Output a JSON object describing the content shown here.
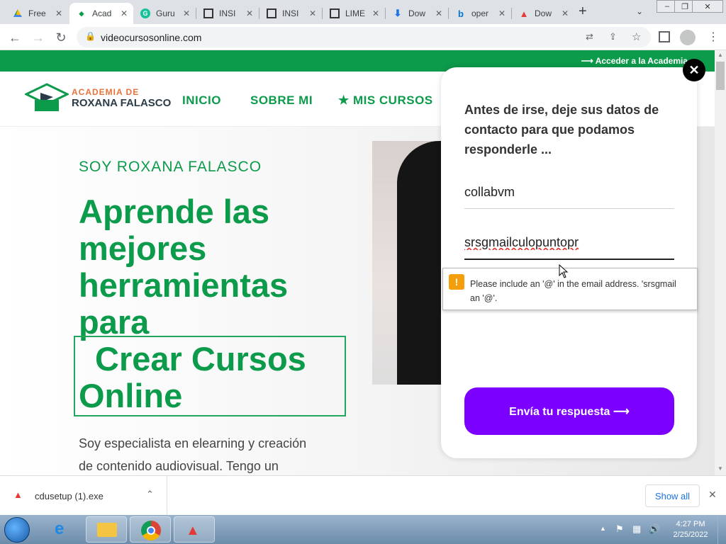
{
  "browser": {
    "tabs": [
      {
        "title": "Free",
        "icon": "google-drive-icon"
      },
      {
        "title": "Acad",
        "icon": "academia-icon"
      },
      {
        "title": "Guru",
        "icon": "grammarly-icon"
      },
      {
        "title": "INSI",
        "icon": "qr-icon"
      },
      {
        "title": "INSI",
        "icon": "qr-icon"
      },
      {
        "title": "LIME",
        "icon": "qr-icon"
      },
      {
        "title": "Dow",
        "icon": "download-icon"
      },
      {
        "title": "oper",
        "icon": "bing-icon"
      },
      {
        "title": "Dow",
        "icon": "anydesk-icon"
      }
    ],
    "url": "videocursosonline.com"
  },
  "site": {
    "top_bar_link": "⟶ Acceder a la Academia",
    "logo_line1": "ACADEMIA  DE",
    "logo_line2": "ROXANA FALASCO",
    "nav": [
      "INICIO",
      "SOBRE MI",
      "★ MIS CURSOS"
    ],
    "hero_kicker": "SOY ROXANA FALASCO",
    "headline": [
      "Aprende las",
      "mejores",
      "herramientas",
      "para",
      "Crear Cursos",
      "Online"
    ],
    "description": [
      "Soy especialista en elearning y creación",
      "de contenido audiovisual. Tengo un"
    ]
  },
  "modal": {
    "message": "Antes de irse, deje sus datos de contacto para que podamos responderle ...",
    "name_value": "collabvm",
    "email_value": "srsgmailculopuntopr",
    "submit_label": "Envía tu respuesta ⟶",
    "close_symbol": "✕"
  },
  "tooltip": {
    "message": "Please include an '@' in the email address. 'srsgmail\nan '@'."
  },
  "downloads": {
    "file": "cdusetup (1).exe",
    "show_all": "Show all"
  },
  "taskbar": {
    "time": "4:27 PM",
    "date": "2/25/2022"
  }
}
